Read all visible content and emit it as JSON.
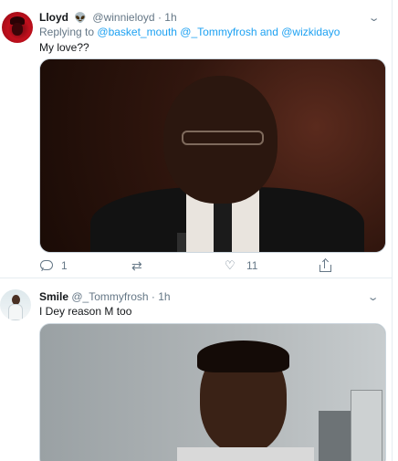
{
  "tweets": [
    {
      "name": "Lloyd",
      "handle": "@winnieloyd",
      "sep": "·",
      "time": "1h",
      "replying_prefix": "Replying to",
      "replying_to": [
        "@basket_mouth",
        "@_Tommyfrosh",
        "and",
        "@wizkidayo"
      ],
      "text": "My love??",
      "actions": {
        "replies": "1",
        "retweets": "",
        "likes": "11"
      }
    },
    {
      "name": "Smile",
      "handle": "@_Tommyfrosh",
      "sep": "·",
      "time": "1h",
      "text": "I Dey reason M too"
    }
  ],
  "icons": {
    "caret": "chevron-down-icon",
    "reply": "reply-icon",
    "retweet": "retweet-icon",
    "like": "heart-icon",
    "share": "share-icon",
    "emoji": "alien-emoji"
  },
  "colors": {
    "link": "#1da1f2",
    "muted": "#657786",
    "text": "#14171a",
    "border": "#e6ecf0"
  }
}
